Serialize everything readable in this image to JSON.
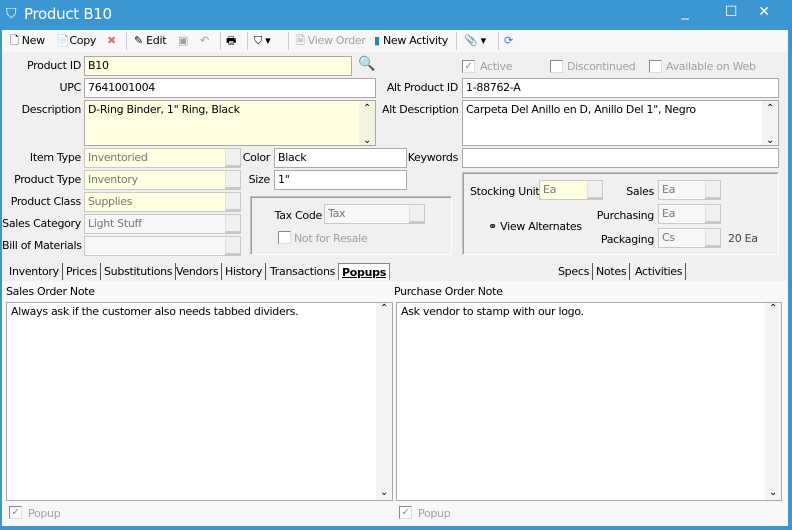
{
  "window": {
    "title": "Product B10",
    "minimize": "_",
    "maximize": "☐",
    "close": "✕"
  },
  "toolbar": {
    "new": "New",
    "copy": "Copy",
    "edit": "Edit",
    "view_order": "View Order",
    "new_activity": "New Activity"
  },
  "form": {
    "product_id_label": "Product ID",
    "product_id": "B10",
    "upc_label": "UPC",
    "upc": "7641001004",
    "description_label": "Description",
    "description": "D-Ring Binder, 1\" Ring, Black",
    "active_label": "Active",
    "active": true,
    "discontinued_label": "Discontinued",
    "discontinued": false,
    "available_web_label": "Available on Web",
    "available_web": false,
    "alt_product_id_label": "Alt Product ID",
    "alt_product_id": "1-88762-A",
    "alt_description_label": "Alt Description",
    "alt_description": "Carpeta Del Anillo en D, Anillo Del 1\", Negro",
    "item_type_label": "Item Type",
    "item_type": "Inventoried",
    "product_type_label": "Product Type",
    "product_type": "Inventory",
    "product_class_label": "Product Class",
    "product_class": "Supplies",
    "sales_category_label": "Sales Category",
    "sales_category": "Light Stuff",
    "bom_label": "Bill of Materials",
    "bom": "",
    "color_label": "Color",
    "color": "Black",
    "size_label": "Size",
    "size": "1\"",
    "keywords_label": "Keywords",
    "keywords": "",
    "tax_code_label": "Tax Code",
    "tax_code": "Tax",
    "not_for_resale_label": "Not for Resale",
    "not_for_resale": false,
    "stocking_unit_label": "Stocking Unit",
    "stocking_unit": "Ea",
    "sales_label": "Sales",
    "sales": "Ea",
    "purchasing_label": "Purchasing",
    "purchasing": "Ea",
    "packaging_label": "Packaging",
    "packaging": "Cs",
    "packaging_qty": "20 Ea",
    "view_alternates": "View Alternates"
  },
  "tabs": [
    {
      "label": "Inventory"
    },
    {
      "label": "Prices"
    },
    {
      "label": "Substitutions"
    },
    {
      "label": "Vendors"
    },
    {
      "label": "History"
    },
    {
      "label": "Transactions"
    },
    {
      "label": "Popups",
      "active": true
    },
    {
      "label": "Specs"
    },
    {
      "label": "Notes"
    },
    {
      "label": "Activities"
    }
  ],
  "popups": {
    "sales_label": "Sales Order Note",
    "sales_note": "Always ask if the customer also needs tabbed dividers.",
    "sales_popup_label": "Popup",
    "sales_popup": true,
    "purchase_label": "Purchase Order Note",
    "purchase_note": "Ask vendor to stamp with our logo.",
    "purchase_popup_label": "Popup",
    "purchase_popup": true
  },
  "colors": {
    "titlebar": "#3c96d2",
    "required_field": "#ffffe1"
  }
}
